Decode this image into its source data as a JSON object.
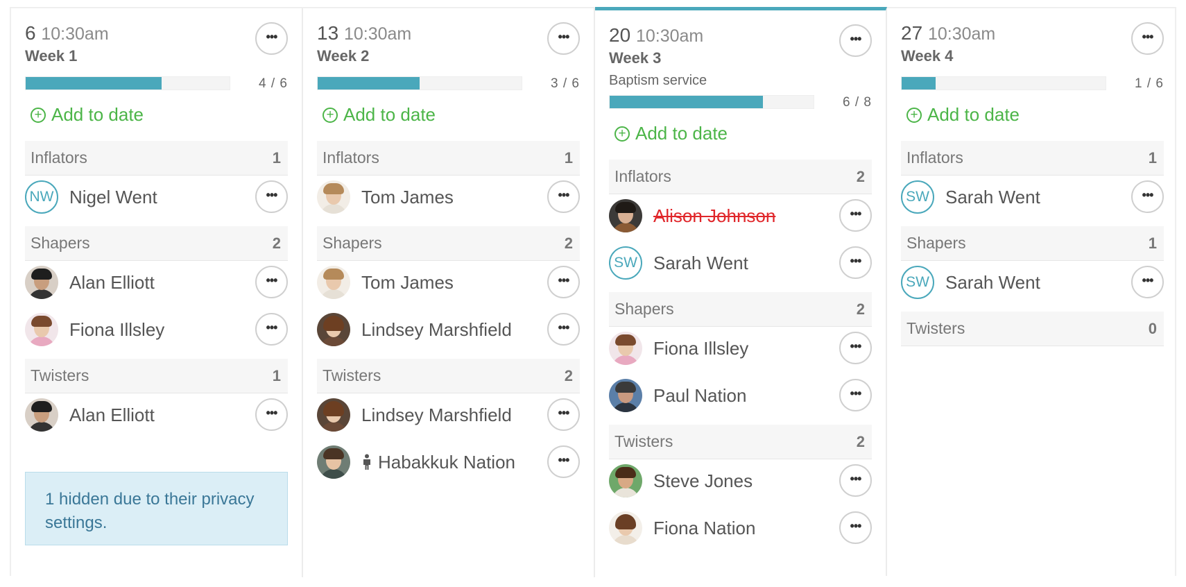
{
  "columns": [
    {
      "day": "6",
      "time": "10:30am",
      "week": "Week 1",
      "subtitle": "",
      "progress": {
        "filled": 4,
        "total": 6,
        "label": "4 / 6"
      },
      "add_label": "Add to date",
      "roles": [
        {
          "name": "Inflators",
          "count": "1",
          "people": [
            {
              "name": "Nigel Went",
              "initials": "NW"
            }
          ]
        },
        {
          "name": "Shapers",
          "count": "2",
          "people": [
            {
              "name": "Alan Elliott"
            },
            {
              "name": "Fiona Illsley"
            }
          ]
        },
        {
          "name": "Twisters",
          "count": "1",
          "people": [
            {
              "name": "Alan Elliott"
            }
          ]
        }
      ],
      "notice": "1 hidden due to their privacy settings."
    },
    {
      "day": "13",
      "time": "10:30am",
      "week": "Week 2",
      "subtitle": "",
      "progress": {
        "filled": 3,
        "total": 6,
        "label": "3 / 6"
      },
      "add_label": "Add to date",
      "roles": [
        {
          "name": "Inflators",
          "count": "1",
          "people": [
            {
              "name": "Tom James"
            }
          ]
        },
        {
          "name": "Shapers",
          "count": "2",
          "people": [
            {
              "name": "Tom James"
            },
            {
              "name": "Lindsey Marshfield"
            }
          ]
        },
        {
          "name": "Twisters",
          "count": "2",
          "people": [
            {
              "name": "Lindsey Marshfield"
            },
            {
              "name": "Habakkuk Nation",
              "child": true
            }
          ]
        }
      ]
    },
    {
      "day": "20",
      "time": "10:30am",
      "week": "Week 3",
      "subtitle": "Baptism service",
      "progress": {
        "filled": 6,
        "total": 8,
        "label": "6 / 8"
      },
      "add_label": "Add to date",
      "roles": [
        {
          "name": "Inflators",
          "count": "2",
          "people": [
            {
              "name": "Alison Johnson",
              "declined": true
            },
            {
              "name": "Sarah Went",
              "initials": "SW"
            }
          ]
        },
        {
          "name": "Shapers",
          "count": "2",
          "people": [
            {
              "name": "Fiona Illsley"
            },
            {
              "name": "Paul Nation"
            }
          ]
        },
        {
          "name": "Twisters",
          "count": "2",
          "people": [
            {
              "name": "Steve Jones"
            },
            {
              "name": "Fiona Nation"
            }
          ]
        }
      ]
    },
    {
      "day": "27",
      "time": "10:30am",
      "week": "Week 4",
      "subtitle": "",
      "progress": {
        "filled": 1,
        "total": 6,
        "label": "1 / 6"
      },
      "add_label": "Add to date",
      "roles": [
        {
          "name": "Inflators",
          "count": "1",
          "people": [
            {
              "name": "Sarah Went",
              "initials": "SW"
            }
          ]
        },
        {
          "name": "Shapers",
          "count": "1",
          "people": [
            {
              "name": "Sarah Went",
              "initials": "SW"
            }
          ]
        },
        {
          "name": "Twisters",
          "count": "0",
          "people": []
        }
      ]
    }
  ],
  "colors": {
    "accent": "#4aa8bb",
    "add": "#4cb548",
    "declined": "#e0262a",
    "notice_bg": "#dbeef6"
  },
  "icons": {
    "more": "ellipsis-icon",
    "add": "plus-circle-icon",
    "child": "child-icon"
  }
}
